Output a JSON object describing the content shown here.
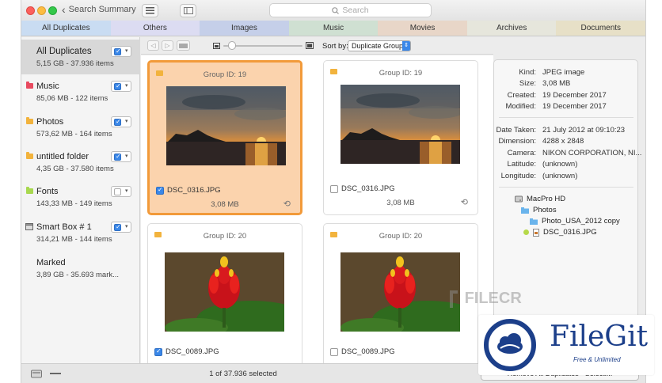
{
  "titlebar": {
    "back_label": "Search Summary",
    "search_placeholder": "Search"
  },
  "tabs": [
    {
      "label": "All Duplicates",
      "color": "#c9dcf2"
    },
    {
      "label": "Others",
      "color": "#dcdcf2"
    },
    {
      "label": "Images",
      "color": "#c5cfe9"
    },
    {
      "label": "Music",
      "color": "#cfe0d2"
    },
    {
      "label": "Movies",
      "color": "#e8d6c8"
    },
    {
      "label": "Archives",
      "color": "#e6e6dc"
    },
    {
      "label": "Documents",
      "color": "#e7e0c7"
    }
  ],
  "sidebar": {
    "items": [
      {
        "name": "All Duplicates",
        "sub": "5,15 GB - 37.936 items",
        "checked": true,
        "folder": ""
      },
      {
        "name": "Music",
        "sub": "85,06 MB - 122 items",
        "checked": true,
        "folder": "#e84a5f"
      },
      {
        "name": "Photos",
        "sub": "573,62 MB - 164 items",
        "checked": true,
        "folder": "#f2b33d"
      },
      {
        "name": "untitled folder",
        "sub": "4,35 GB - 37.580 items",
        "checked": true,
        "folder": "#f2b33d"
      },
      {
        "name": "Fonts",
        "sub": "143,33 MB - 149 items",
        "checked": false,
        "folder": "#a8d84f"
      },
      {
        "name": "Smart Box # 1",
        "sub": "314,21 MB - 144 items",
        "checked": true,
        "folder": ""
      },
      {
        "name": "Marked",
        "sub": "3,89 GB - 35.693 mark...",
        "checked": null,
        "folder": ""
      }
    ]
  },
  "toolbar": {
    "sort_label": "Sort by:",
    "sort_value": "Duplicate Group"
  },
  "cards": [
    {
      "group": "Group ID: 19",
      "file": "DSC_0316.JPG",
      "size": "3,08 MB",
      "checked": true,
      "selected": true,
      "image": "sunset"
    },
    {
      "group": "Group ID: 19",
      "file": "DSC_0316.JPG",
      "size": "3,08 MB",
      "checked": false,
      "selected": false,
      "image": "sunset"
    },
    {
      "group": "Group ID: 20",
      "file": "DSC_0089.JPG",
      "size": "",
      "checked": true,
      "selected": false,
      "image": "flower"
    },
    {
      "group": "Group ID: 20",
      "file": "DSC_0089.JPG",
      "size": "",
      "checked": false,
      "selected": false,
      "image": "flower"
    }
  ],
  "info": {
    "rows": [
      {
        "k": "Kind:",
        "v": "JPEG image"
      },
      {
        "k": "Size:",
        "v": "3,08 MB"
      },
      {
        "k": "Created:",
        "v": "19 December 2017"
      },
      {
        "k": "Modified:",
        "v": "19 December 2017"
      },
      {
        "k": "Date Taken:",
        "v": "21 July 2012 at 09:10:23"
      },
      {
        "k": "Dimension:",
        "v": "4288 x 2848"
      },
      {
        "k": "Camera:",
        "v": "NIKON CORPORATION, NI..."
      },
      {
        "k": "Latitude:",
        "v": "(unknown)"
      },
      {
        "k": "Longitude:",
        "v": "(unknown)"
      }
    ],
    "path": {
      "disk": "MacPro HD",
      "folder1": "Photos",
      "folder2": "Photo_USA_2012 copy",
      "file": "DSC_0316.JPG"
    }
  },
  "status": {
    "text": "1 of 37.936 selected",
    "button_text": "Remove All Duplicates - Selecti..."
  },
  "watermarks": {
    "filecr": "FILECR",
    "filegit_name": "FileGit",
    "filegit_tag": "Free & Unlimited"
  }
}
